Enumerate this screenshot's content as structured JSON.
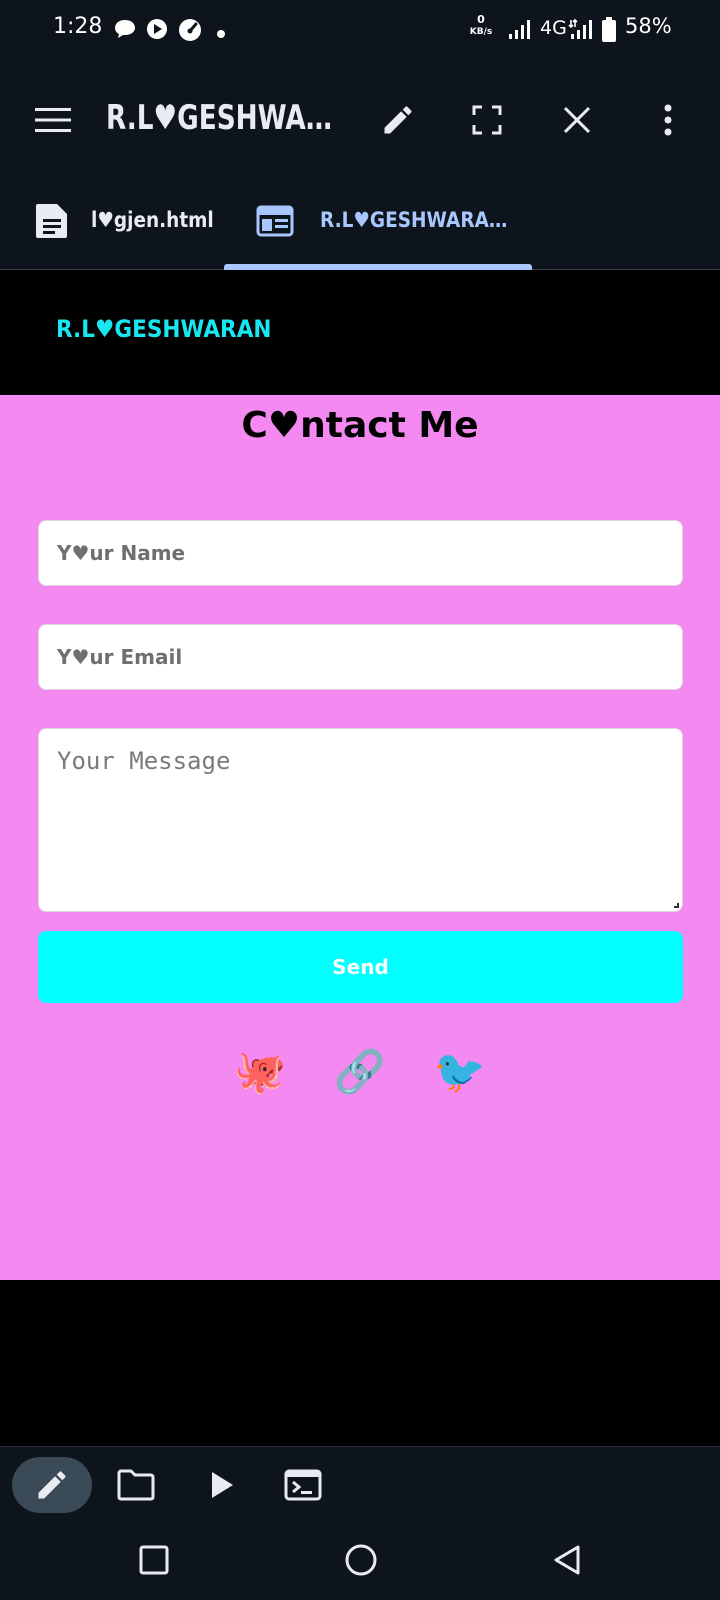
{
  "status_bar": {
    "time": "1:28",
    "net_speed_value": "0",
    "net_speed_unit": "KB/s",
    "network": "4G",
    "battery": "58%"
  },
  "app_bar": {
    "title": "R.L♥GESHWA…",
    "icons": [
      "menu-icon",
      "edit-icon",
      "fullscreen-icon",
      "close-icon",
      "more-vert-icon"
    ]
  },
  "tabs": [
    {
      "label": "l♥gjen.html",
      "icon": "document-icon",
      "active": false
    },
    {
      "label": "R.L♥GESHWARA…",
      "icon": "browser-preview-icon",
      "active": true
    }
  ],
  "site": {
    "logo": "R.L♥GESHWARAN",
    "contact_title": "C♥ntact Me",
    "name_placeholder": "Y♥ur Name",
    "email_placeholder": "Y♥ur Email",
    "message_placeholder": "Your Message",
    "send_label": "Send",
    "social_icons": [
      "🐙",
      "🔗",
      "🐦"
    ]
  },
  "bottom_toolbar": {
    "icons": [
      "edit-icon",
      "folder-icon",
      "play-icon",
      "terminal-icon"
    ]
  },
  "colors": {
    "app_bg": "#0e141b",
    "accent": "#a9c7ff",
    "contact_bg": "#f389f1",
    "send_bg": "#00ffff",
    "logo": "#18e6f0"
  }
}
